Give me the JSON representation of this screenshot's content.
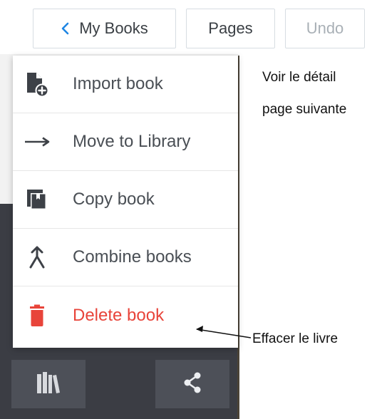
{
  "toolbar": {
    "my_books_label": "My Books",
    "pages_label": "Pages",
    "undo_label": "Undo"
  },
  "menu": {
    "items": [
      {
        "label": "Import book",
        "icon": "import-book-icon"
      },
      {
        "label": "Move to Library",
        "icon": "arrow-right-icon"
      },
      {
        "label": "Copy book",
        "icon": "copy-book-icon"
      },
      {
        "label": "Combine books",
        "icon": "combine-icon"
      },
      {
        "label": "Delete book",
        "icon": "trash-icon",
        "color": "#e8443a"
      }
    ]
  },
  "bottom_bar": {
    "library_icon": "library-icon",
    "share_icon": "share-icon"
  },
  "annotations": {
    "line1": "Voir le détail",
    "line2": "page suivante",
    "delete_note": "Effacer le livre"
  },
  "colors": {
    "accent": "#1f86e3",
    "danger": "#e8443a",
    "dark_bg": "#3b3d44",
    "button_dark": "#4d5058"
  }
}
